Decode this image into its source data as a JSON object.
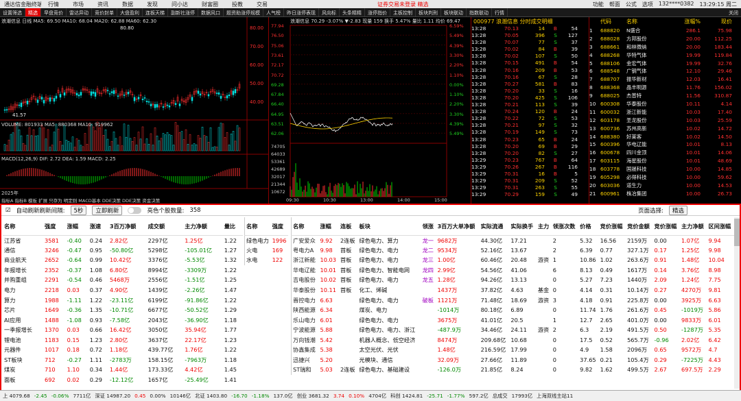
{
  "menubar": {
    "app": "通达信金融终端",
    "items": [
      "行情",
      "市场",
      "资讯",
      "数据",
      "发现",
      "问小达",
      "财富圈",
      "投教",
      "交易"
    ],
    "alert": "证券交易未登录 精选",
    "right": [
      "功能",
      "帮面",
      "公式",
      "选项"
    ],
    "user": "132****0382",
    "time": "13:29:15 周二"
  },
  "tabs": [
    "设置筛选",
    "精选",
    "早盘竞价",
    "雷达异动",
    "竞价封单",
    "大盘盈利",
    "连板天梯",
    "副新社涨停",
    "数据风口",
    "题资助涨停规模",
    "人气榜",
    "昨日涨停表现",
    "风向标",
    "头条精精",
    "涨停指价",
    "主板控制",
    "板块判刑",
    "板块联动",
    "指数联动",
    "行情"
  ],
  "active_tab": "精选",
  "close_label": "关闭",
  "kline": {
    "header": "浪潮信息 日线  MA5: 69.50  MA10: 68.04  MA20: 62.88  MA60: 62.30",
    "high": "80.80",
    "low": "41.57",
    "vol": "VOLUME: 801933  MA5: 880368  MA10: 919962",
    "macd": "MACD(12,26,9)  DIF: 2.72  DEA: 1.59  MACD: 2.25",
    "yticks": [
      "80.00",
      "70.00",
      "60.00",
      "50.00",
      "40.00"
    ],
    "foot": "指标A  指标B  模板  扩展  只存为  明定则  MACD基本  DDE决策  DDE决策  资金决策",
    "year": "2025年"
  },
  "intraday": {
    "header": "浪潮信息  70.29 -3.07% ▼-2.83 现量 159 换手 5.47% 量比 1.11 均价 69.47",
    "left": [
      "77.94",
      "76.50",
      "75.06",
      "73.61",
      "72.17",
      "70.72",
      "69.28",
      "67.84",
      "66.40",
      "64.95",
      "63.51",
      "62.06"
    ],
    "right": [
      "6.59%",
      "5.49%",
      "4.39%",
      "3.30%",
      "2.20%",
      "1.10%",
      "0.00%",
      "1.10%",
      "2.20%",
      "3.30%",
      "4.39%",
      "5.49%"
    ],
    "vleft": [
      "74705",
      "64033",
      "53361",
      "42689",
      "32017",
      "21344",
      "10672"
    ],
    "times": [
      "09:30",
      "10:30",
      "13:00",
      "14:00",
      "15:00"
    ]
  },
  "ticks": {
    "header": "000977 浪潮信息  分时成交明细",
    "rows": [
      [
        "13:28",
        "70.13",
        "14",
        "B",
        "54"
      ],
      [
        "13:28",
        "70.05",
        "396",
        "S",
        "127"
      ],
      [
        "13:28",
        "70.07",
        "77",
        "S",
        "37"
      ],
      [
        "13:28",
        "70.02",
        "84",
        "B",
        "39"
      ],
      [
        "13:28",
        "70.02",
        "107",
        "S",
        "50"
      ],
      [
        "13:28",
        "70.15",
        "491",
        "B",
        "54"
      ],
      [
        "13:28",
        "70.16",
        "209",
        "B",
        "53"
      ],
      [
        "13:28",
        "70.16",
        "67",
        "S",
        "28"
      ],
      [
        "13:28",
        "70.27",
        "581",
        "B",
        "83"
      ],
      [
        "13:28",
        "70.20",
        "33",
        "S",
        "16"
      ],
      [
        "13:28",
        "70.20",
        "425",
        "S",
        "106"
      ],
      [
        "13:28",
        "70.21",
        "113",
        "S",
        "39"
      ],
      [
        "13:28",
        "70.24",
        "120",
        "B",
        "24"
      ],
      [
        "13:28",
        "70.22",
        "72",
        "S",
        "53"
      ],
      [
        "13:28",
        "70.21",
        "97",
        "S",
        "32"
      ],
      [
        "13:28",
        "70.19",
        "149",
        "S",
        "73"
      ],
      [
        "13:28",
        "70.23",
        "65",
        "B",
        "24"
      ],
      [
        "13:28",
        "70.20",
        "69",
        "B",
        "29"
      ],
      [
        "13:28",
        "70.20",
        "82",
        "S",
        "27"
      ],
      [
        "13:29",
        "70.23",
        "767",
        "B",
        "64"
      ],
      [
        "13:29",
        "70.26",
        "267",
        "B",
        "116"
      ],
      [
        "13:29",
        "70.31",
        "16",
        "B",
        "5"
      ],
      [
        "13:29",
        "70.31",
        "209",
        "S",
        "52"
      ],
      [
        "13:29",
        "70.31",
        "263",
        "S",
        "55"
      ],
      [
        "13:29",
        "70.29",
        "159",
        "S",
        "49"
      ]
    ]
  },
  "rank": {
    "headers": [
      "",
      "代码",
      "名称",
      "涨幅%",
      "现价"
    ],
    "rows": [
      [
        "1",
        "688820",
        "N盛合",
        "286.1",
        "75.98"
      ],
      [
        "2",
        "688028",
        "方邦股份",
        "20.00",
        "112.25"
      ],
      [
        "3",
        "688661",
        "和林微纳",
        "20.00",
        "183.44"
      ],
      [
        "4",
        "688268",
        "华特气体",
        "19.99",
        "119.84"
      ],
      [
        "5",
        "688106",
        "金宏气体",
        "19.99",
        "32.76"
      ],
      [
        "6",
        "688548",
        "广钢气体",
        "12.10",
        "29.46"
      ],
      [
        "7",
        "688707",
        "振华新材",
        "12.03",
        "16.41"
      ],
      [
        "8",
        "688368",
        "晶丰明源",
        "11.76",
        "156.02"
      ],
      [
        "9",
        "688025",
        "杰普特",
        "11.56",
        "310.87"
      ],
      [
        "10",
        "600308",
        "华泰股份",
        "10.11",
        "4.14"
      ],
      [
        "11",
        "600032",
        "浙江新能",
        "10.03",
        "17.40"
      ],
      [
        "12",
        "603178",
        "圣龙股份",
        "10.03",
        "25.59"
      ],
      [
        "13",
        "600736",
        "苏州高新",
        "10.02",
        "14.72"
      ],
      [
        "14",
        "688380",
        "好莱客",
        "10.02",
        "14.50"
      ],
      [
        "15",
        "600396",
        "华电辽能",
        "10.01",
        "8.13"
      ],
      [
        "16",
        "600678",
        "四川金顶",
        "10.01",
        "14.06"
      ],
      [
        "17",
        "603115",
        "海星股份",
        "10.01",
        "48.69"
      ],
      [
        "18",
        "603778",
        "国晟科技",
        "10.00",
        "14.85"
      ],
      [
        "19",
        "605298",
        "必得科技",
        "10.00",
        "59.62"
      ],
      [
        "20",
        "603036",
        "道生力",
        "10.00",
        "14.53"
      ],
      [
        "21",
        "600961",
        "株冶集团",
        "10.00",
        "26.73"
      ]
    ]
  },
  "controls": {
    "auto_label": "自动刷新刷新间隔:",
    "interval": "5秒",
    "refresh_btn": "立即刷新",
    "bright_label": "亮色个股数量:",
    "bright_count": "358",
    "page_label": "页面选择:",
    "page_value": "精选"
  },
  "t1": {
    "headers": [
      "名称",
      "强度",
      "涨幅",
      "涨速",
      "3百万净额",
      "成交额",
      "主力净额",
      "量比"
    ],
    "rows": [
      [
        "江苏省",
        "3581",
        "-0.40",
        "0.24",
        "2.82亿",
        "2297亿",
        "1.25亿",
        "1.22"
      ],
      [
        "通信",
        "3246",
        "-0.47",
        "0.95",
        "-50.80亿",
        "5298亿",
        "-105.01亿",
        "1.27"
      ],
      [
        "商业航天",
        "2652",
        "-0.64",
        "0.99",
        "10.42亿",
        "3376亿",
        "-5.53亿",
        "1.32"
      ],
      [
        "年报增长",
        "2352",
        "-0.37",
        "1.08",
        "6.80亿",
        "8994亿",
        "-3309万",
        "1.22"
      ],
      [
        "并购重组",
        "2291",
        "-0.54",
        "0.46",
        "5468万",
        "2556亿",
        "-1.51亿",
        "1.25"
      ],
      [
        "电力",
        "2218",
        "0.03",
        "0.37",
        "4.90亿",
        "1439亿",
        "-2.26亿",
        "1.47"
      ],
      [
        "算力",
        "1988",
        "-1.11",
        "1.22",
        "-23.11亿",
        "6199亿",
        "-91.86亿",
        "1.22"
      ],
      [
        "芯片",
        "1649",
        "-0.36",
        "1.35",
        "-10.71亿",
        "6677亿",
        "-50.52亿",
        "1.29"
      ],
      [
        "AI应用",
        "1488",
        "-1.08",
        "0.93",
        "-7.58亿",
        "2043亿",
        "-36.90亿",
        "1.18"
      ],
      [
        "一季报增长",
        "1370",
        "0.03",
        "0.66",
        "16.42亿",
        "3050亿",
        "35.94亿",
        "1.77"
      ],
      [
        "锂电池",
        "1183",
        "0.15",
        "1.23",
        "2.80亿",
        "3637亿",
        "22.17亿",
        "1.23"
      ],
      [
        "元器件",
        "1017",
        "0.18",
        "0.72",
        "1.18亿",
        "439.77亿",
        "1.76亿",
        "1.22"
      ],
      [
        "ST板块",
        "712",
        "-0.27",
        "1.11",
        "-2783万",
        "158.15亿",
        "-7963万",
        "1.18"
      ],
      [
        "煤炭",
        "710",
        "1.10",
        "0.34",
        "1.44亿",
        "173.33亿",
        "4.42亿",
        "1.45"
      ],
      [
        "面板",
        "692",
        "0.02",
        "0.29",
        "-12.12亿",
        "1657亿",
        "-25.49亿",
        "1.41"
      ]
    ]
  },
  "t2": {
    "headers": [
      "名称",
      "强度"
    ],
    "rows": [
      [
        "绿色电力",
        "1996"
      ],
      [
        "火电",
        "169"
      ],
      [
        "水电",
        "122"
      ]
    ]
  },
  "t3": {
    "headers": [
      "名称",
      "涨幅",
      "连板",
      "板块",
      "领涨",
      "3百万大单净额",
      "实际流通",
      "实际换手",
      "主力",
      "领涨次数",
      "价格",
      "竞价涨幅",
      "竞价金额",
      "竞价涨幅",
      "主力净额",
      "区间涨幅"
    ],
    "rows": [
      [
        "广安爱众",
        "9.92",
        "2连板",
        "绿色电力、算力",
        "龙一",
        "9682万",
        "44.30亿",
        "17.21",
        "",
        "2",
        "5.32",
        "16.56",
        "2159万",
        "0.00",
        "1.07亿",
        "9.94"
      ],
      [
        "粤电力A",
        "9.98",
        "首板",
        "绿色电力、电力",
        "龙二",
        "9534万",
        "52.16亿",
        "13.67",
        "",
        "2",
        "6.39",
        "0.77",
        "327.1万",
        "0.17",
        "1.25亿",
        "9.98"
      ],
      [
        "浙江新能",
        "10.03",
        "首板",
        "绿色电力、电力",
        "龙三",
        "1.00亿",
        "60.46亿",
        "20.48",
        "游资",
        "1",
        "10.86",
        "1.02",
        "263.6万",
        "0.91",
        "1.48亿",
        "10.04"
      ],
      [
        "华电辽能",
        "10.01",
        "首板",
        "绿色电力、智能电网",
        "龙四",
        "2.99亿",
        "54.56亿",
        "41.06",
        "",
        "6",
        "8.13",
        "0.49",
        "1617万",
        "0.14",
        "3.76亿",
        "8.98"
      ],
      [
        "吉电股份",
        "10.02",
        "首板",
        "绿色电力、电力",
        "龙五",
        "1.28亿",
        "94.26亿",
        "13.13",
        "",
        "0",
        "5.27",
        "7.23",
        "1440万",
        "2.09",
        "1.24亿",
        "7.75"
      ],
      [
        "华泰股份",
        "10.11",
        "首板",
        "化工、烯碱",
        "",
        "1437万",
        "37.82亿",
        "4.63",
        "基金",
        "0",
        "4.14",
        "0.31",
        "10.14万",
        "0.27",
        "4270万",
        "9.81"
      ],
      [
        "晋控电力",
        "6.63",
        "",
        "绿色电力、电力",
        "破板",
        "1121万",
        "71.48亿",
        "18.69",
        "游资",
        "3",
        "4.18",
        "0.91",
        "225.8万",
        "0.00",
        "3925万",
        "6.63"
      ],
      [
        "陕西能源",
        "6.34",
        "",
        "煤炭、电力",
        "",
        "-1014万",
        "80.18亿",
        "6.89",
        "",
        "0",
        "11.74",
        "1.76",
        "261.6万",
        "0.45",
        "-1019万",
        "5.86"
      ],
      [
        "乐山电力",
        "6.01",
        "",
        "绿色电力、电力",
        "",
        "3675万",
        "41.01亿",
        "20.5",
        "",
        "1",
        "12.7",
        "2.65",
        "401.0万",
        "0.00",
        "9833万",
        "6.01"
      ],
      [
        "宁波能源",
        "5.88",
        "",
        "绿色电力、电力、浙江",
        "",
        "-487.9万",
        "34.46亿",
        "24.11",
        "游资",
        "2",
        "6.3",
        "2.19",
        "491.5万",
        "0.50",
        "-1287万",
        "5.35"
      ],
      [
        "万向钱潮",
        "5.42",
        "",
        "机器人概念、低空经济",
        "",
        "8474万",
        "209.68亿",
        "10.68",
        "",
        "0",
        "17.5",
        "0.52",
        "565.7万",
        "-0.96",
        "2.02亿",
        "6.42"
      ],
      [
        "协鑫集成",
        "5.38",
        "",
        "太空光伏、光伏",
        "",
        "1.48亿",
        "216.59亿",
        "17.99",
        "",
        "0",
        "4.9",
        "1.58",
        "2096万",
        "0.65",
        "9572万",
        "4.7"
      ],
      [
        "迅捷兴",
        "5.20",
        "",
        "光模块、通信",
        "",
        "32.09万",
        "27.66亿",
        "11.89",
        "",
        "0",
        "37.65",
        "0.21",
        "105.4万",
        "0.29",
        "-7225万",
        "4.43"
      ],
      [
        "ST瑞和",
        "5.03",
        "2连板",
        "绿色电力、基础建设",
        "",
        "-126.0万",
        "21.85亿",
        "8.24",
        "",
        "0",
        "9.82",
        "1.62",
        "499.5万",
        "2.67",
        "697.5万",
        "2.29"
      ]
    ]
  },
  "status": {
    "items": [
      "上 4079.68",
      "-2.45",
      "-0.06%",
      "7711亿",
      "深证 14987.20",
      "0.45",
      "0.00%",
      "10146亿",
      "北证 1403.80",
      "-16.70",
      "-1.18%",
      "137.0亿",
      "创业 3681.32",
      "3.74",
      "0.10%",
      "4704亿",
      "科创 1424.81",
      "-25.71",
      "-1.77%",
      "597.2亿",
      "总成交",
      "17993亿",
      "上海双线主站11"
    ]
  }
}
